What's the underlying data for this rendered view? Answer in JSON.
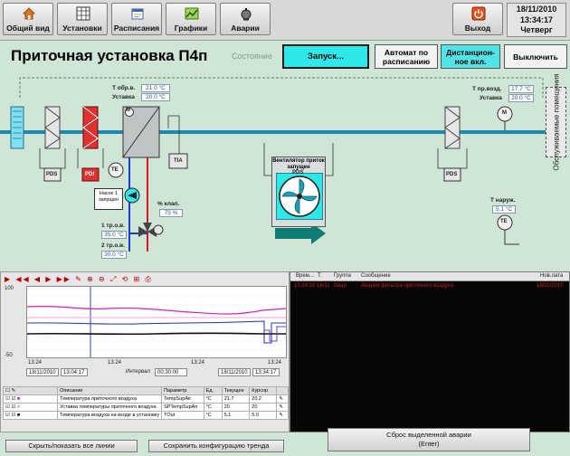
{
  "toolbar": {
    "buttons": [
      {
        "label": "Общий вид",
        "icon": "house-icon"
      },
      {
        "label": "Установки",
        "icon": "grid-icon"
      },
      {
        "label": "Расписания",
        "icon": "calendar-icon"
      },
      {
        "label": "Графики",
        "icon": "chart-icon"
      },
      {
        "label": "Аварии",
        "icon": "alarm-icon"
      }
    ],
    "exit_label": "Выход",
    "clock": {
      "date": "18/11/2010",
      "time": "13:34:17",
      "day": "Четверг"
    }
  },
  "header": {
    "title": "Приточная установка П4п",
    "state_label": "Состояние",
    "start_button": "Запуск...",
    "auto_button": "Автомат по расписанию",
    "remote_button": "Дистанцион-ное вкл.",
    "off_button": "Выключить"
  },
  "schematic": {
    "t_supply_label": "Т обр.в.",
    "t_supply_value": "21.0 °C",
    "setpoint_label": "Уставка",
    "setpoint_value": "20.0 °C",
    "fan_label": "Вентилятор приток",
    "fan_state": "запущен",
    "pump_label": "Насос 1",
    "pump_state": "запущен",
    "valve_label": "% клап.",
    "valve_value": "75 %",
    "t_return1_label": "1 тр.о.в.",
    "t_return1_value": "35.0 °C",
    "t_return2_label": "2 тр.о.в.",
    "t_return2_value": "30.0 °C",
    "t_room_label": "Т пр.возд.",
    "t_room_value": "17.7 °C",
    "room_setpoint_label": "Уставка",
    "room_setpoint_value": "20.0 °C",
    "t_outdoor_label": "Т наруж.",
    "t_outdoor_value": "5.1 °C",
    "serviced_label": "Обслуживаемые помещения",
    "pds_label": "PDS",
    "pdi_label": "PDI",
    "te_label": "TE",
    "tia_label": "TIA",
    "m_label": "M"
  },
  "trend": {
    "y_top": "100",
    "y_bottom": "-50",
    "x_labels": [
      "13:24",
      "13:24",
      "13:24",
      "13:24"
    ],
    "from_date": "18/11/2010",
    "from_time": "13:04:17",
    "interval_label": "Интервал",
    "interval_value": "00:30:00",
    "to_date": "18/11/2010",
    "to_time": "13:34:17",
    "columns": [
      "Описание",
      "Параметр",
      "Ед.",
      "Текущее",
      "Курсор"
    ],
    "rows": [
      {
        "desc": "Температура приточного воздуха",
        "param": "TempSupAir",
        "unit": "°C",
        "current": "21.7",
        "cursor": "20.2"
      },
      {
        "desc": "Уставка температуры приточного воздуха",
        "param": "SPTempSupAir",
        "unit": "°C",
        "current": "20",
        "cursor": "20"
      },
      {
        "desc": "Температура воздуха на входе в установку",
        "param": "TOut",
        "unit": "°C",
        "current": "5.1",
        "cursor": "5.0"
      }
    ]
  },
  "alarms": {
    "columns": [
      "Врем...",
      "Т.",
      "Группа",
      "Сообщение",
      "Нов.лата"
    ],
    "row": {
      "time": "13:24:10 18/11",
      "type": "Авар",
      "message": "Авария фильтра приточного воздуха",
      "date": "18/11/2010"
    }
  },
  "bottom": {
    "hide_all": "Скрыть/показать все линии",
    "save_config": "Сохранить конфигурацию тренда",
    "reset_alarm": "Сброс выделенной аварии",
    "reset_hint": "(Enter)"
  },
  "colors": {
    "bg": "#cfe6d6",
    "cyan_button": "#2de8ea",
    "duct": "#1e88b0",
    "trend_pink": "#d020c8",
    "trend_black": "#111111",
    "trend_blue": "#2030c0",
    "alarm_red": "#d81a1a"
  }
}
